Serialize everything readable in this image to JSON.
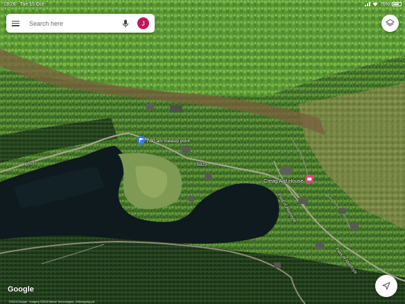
{
  "status_bar": {
    "time": "19:26",
    "date": "Tue 15 Oct",
    "battery": "70%",
    "battery_level": 0.7,
    "icons": [
      "signal-icon",
      "wifi-icon"
    ]
  },
  "search": {
    "placeholder": "Search here",
    "avatar_initial": "J",
    "avatar_color": "#c2185b"
  },
  "map": {
    "pins": [
      {
        "label": "7.30 am meetup point",
        "icon": "flag-pin-icon",
        "color": "#3b78e7"
      },
      {
        "label": "Creag Ard House",
        "icon": "hotel-pin-icon",
        "color": "#e8457c"
      }
    ],
    "roads": [
      "B829",
      "B829",
      "Pass of Aberfoyle",
      "Pass of Aberfoyle"
    ],
    "logo": "Google",
    "attribution": "©2019 Google · Imagery ©2019 Maxar Technologies, Getmapping plc"
  },
  "controls": {
    "layers": "layers-icon",
    "locate": "navigation-arrow-icon"
  }
}
